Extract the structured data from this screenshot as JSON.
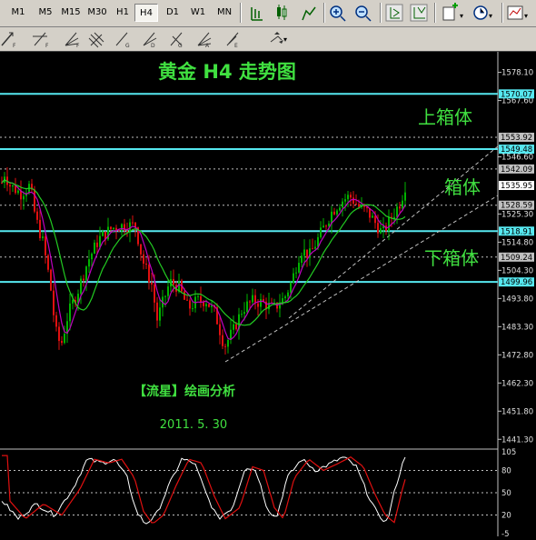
{
  "toolbar": {
    "timeframes": [
      "M1",
      "M5",
      "M15",
      "M30",
      "H1",
      "H4",
      "D1",
      "W1",
      "MN"
    ],
    "active_timeframe": "H4"
  },
  "chart": {
    "title": "黄金 H4 走势图",
    "zone_labels": {
      "upper_box": "上箱体",
      "box": "箱体",
      "lower_box": "下箱体"
    },
    "author": "【流星】绘画分析",
    "date": "2011. 5. 30",
    "price_ticks": [
      "1578.10",
      "1567.60",
      "1546.60",
      "1525.30",
      "1514.80",
      "1504.30",
      "1493.80",
      "1483.30",
      "1472.80",
      "1462.30",
      "1451.80",
      "1441.30"
    ],
    "price_markers": [
      {
        "value": "1570.07",
        "color": "#56e8f0",
        "level": 1570.07
      },
      {
        "value": "1553.92",
        "color": "#c0c0c0",
        "level": 1553.92
      },
      {
        "value": "1549.48",
        "color": "#56e8f0",
        "level": 1549.48
      },
      {
        "value": "1542.09",
        "color": "#c0c0c0",
        "level": 1542.09
      },
      {
        "value": "1535.95",
        "color": "#ffffff",
        "level": 1535.95
      },
      {
        "value": "1528.59",
        "color": "#c0c0c0",
        "level": 1528.59
      },
      {
        "value": "1518.91",
        "color": "#56e8f0",
        "level": 1518.91
      },
      {
        "value": "1509.24",
        "color": "#c0c0c0",
        "level": 1509.24
      },
      {
        "value": "1499.96",
        "color": "#56e8f0",
        "level": 1499.96
      }
    ],
    "oscillator_ticks": [
      "105",
      "80",
      "50",
      "20",
      "-5"
    ],
    "colors": {
      "bull": "#00b300",
      "bear": "#e01010",
      "ma_fast": "#c000c0",
      "ma_slow": "#22cc22",
      "hline": "#56e8f0",
      "dashed": "#c0c0c0",
      "label_green": "#40e040"
    }
  }
}
